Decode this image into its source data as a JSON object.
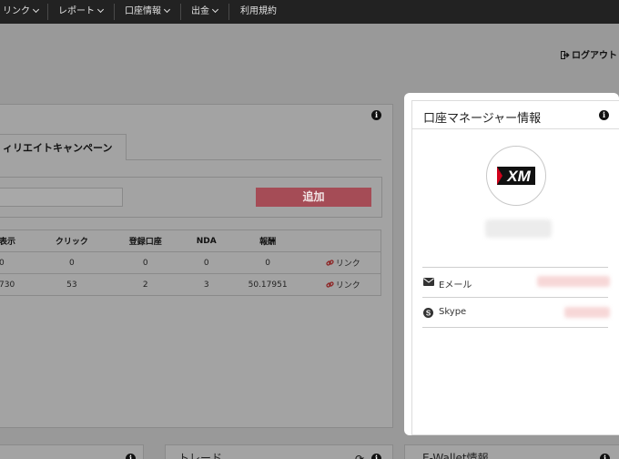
{
  "nav": {
    "items": [
      {
        "label": "リンク",
        "dropdown": true
      },
      {
        "label": "レポート",
        "dropdown": true
      },
      {
        "label": "口座情報",
        "dropdown": true
      },
      {
        "label": "出金",
        "dropdown": true
      },
      {
        "label": "利用規約",
        "dropdown": false
      }
    ]
  },
  "header": {
    "logout_label": "ログアウト"
  },
  "campaign_panel": {
    "tab_label": "ィリエイトキャンペーン",
    "campaign_input": {
      "value": "",
      "placeholder": ""
    },
    "add_button_label": "追加",
    "table": {
      "columns": [
        "表示",
        "クリック",
        "登録口座",
        "NDA",
        "報酬",
        ""
      ],
      "rows": [
        [
          "0",
          "0",
          "0",
          "0",
          "0",
          "リンク"
        ],
        [
          "730",
          "53",
          "2",
          "3",
          "50.17951",
          "リンク"
        ]
      ]
    }
  },
  "manager_panel": {
    "title": "口座マネージャー情報",
    "logo_text": "XM",
    "email_label": "Eメール",
    "skype_label": "Skype"
  },
  "bottom_panels": {
    "trade_title": "トレード",
    "ewallet_title": "E-Wallet情報"
  },
  "colors": {
    "nav_bg": "#222222",
    "overlay_bg": "#999999",
    "add_button": "#a54c56",
    "link": "#8c1c1c",
    "logo_red": "#d0021b"
  }
}
